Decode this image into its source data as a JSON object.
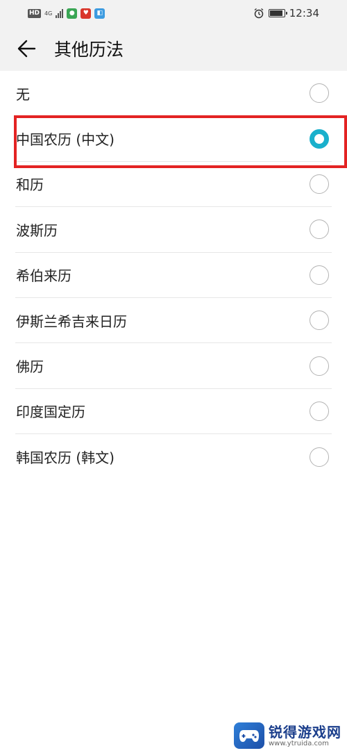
{
  "status_bar": {
    "hd": "HD",
    "network": "4G",
    "time": "12:34",
    "battery_level": 0.9
  },
  "header": {
    "title": "其他历法",
    "back_icon": "arrow-left-icon"
  },
  "options": [
    {
      "label": "无",
      "checked": false
    },
    {
      "label": "中国农历 (中文)",
      "checked": true
    },
    {
      "label": "和历",
      "checked": false
    },
    {
      "label": "波斯历",
      "checked": false
    },
    {
      "label": "希伯来历",
      "checked": false
    },
    {
      "label": "伊斯兰希吉来日历",
      "checked": false
    },
    {
      "label": "佛历",
      "checked": false
    },
    {
      "label": "印度国定历",
      "checked": false
    },
    {
      "label": "韩国农历 (韩文)",
      "checked": false
    }
  ],
  "colors": {
    "accent": "#1ab0cc",
    "highlight": "#e32323",
    "header_bg": "#f2f2f2"
  },
  "watermark": {
    "title": "锐得游戏网",
    "url": "www.ytruida.com"
  }
}
